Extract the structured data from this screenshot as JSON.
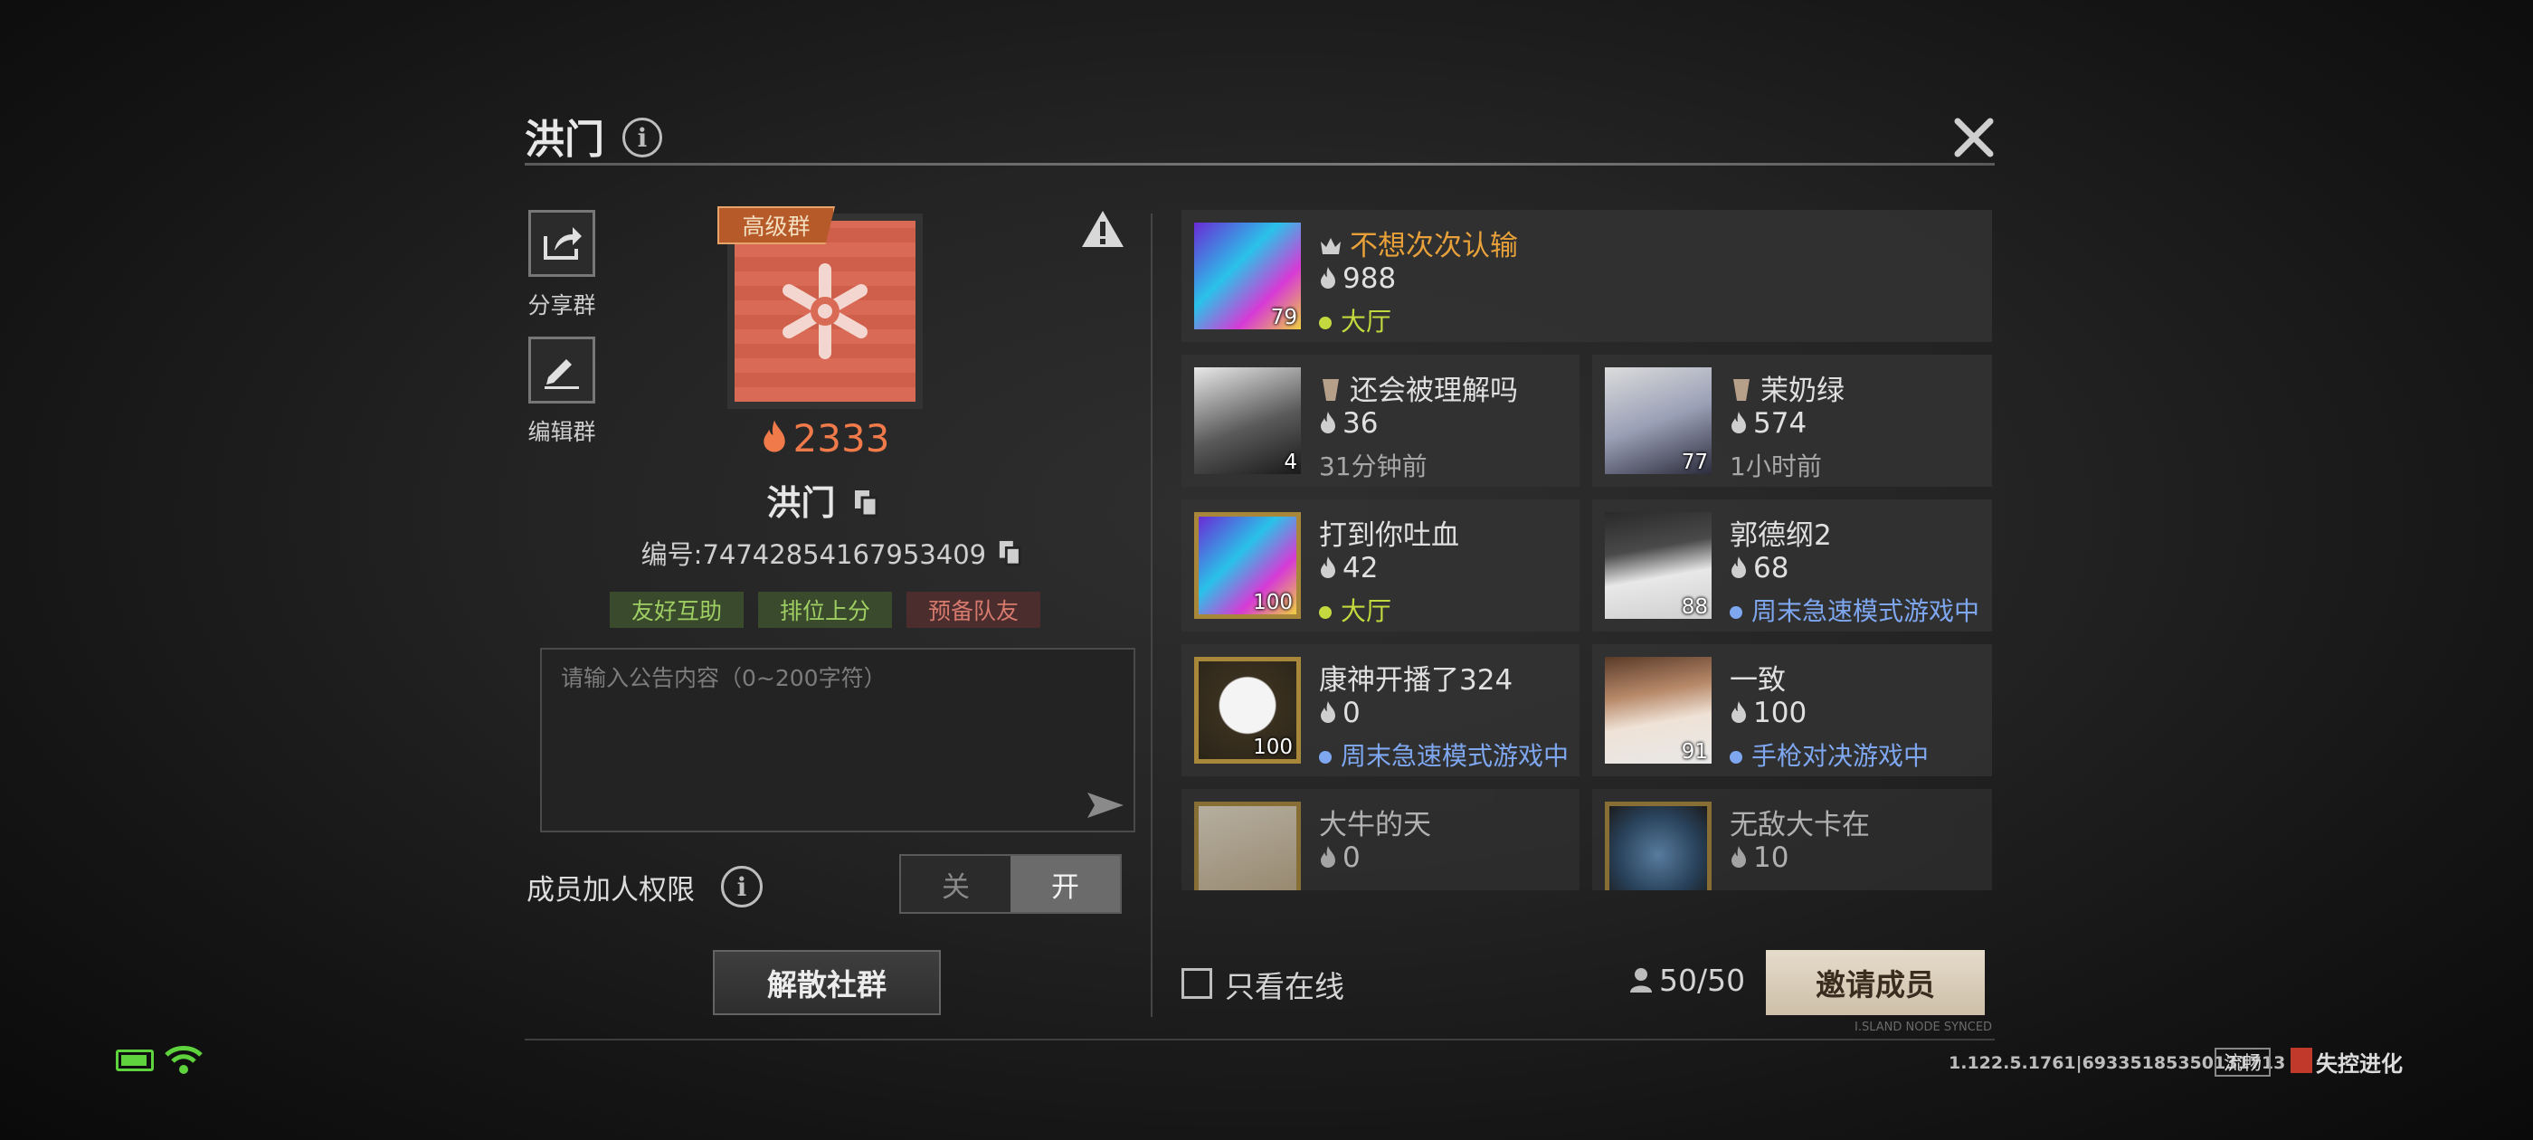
{
  "header": {
    "title": "洪门"
  },
  "side": {
    "share_label": "分享群",
    "edit_label": "编辑群"
  },
  "group": {
    "badge": "高级群",
    "score": "2333",
    "name": "洪门",
    "id_text": "编号:74742854167953409",
    "tags": [
      "友好互助",
      "排位上分",
      "预备队友"
    ]
  },
  "notice": {
    "placeholder": "请输入公告内容（0~200字符）"
  },
  "permission": {
    "label": "成员加人权限",
    "off": "关",
    "on": "开"
  },
  "actions": {
    "disband": "解散社群",
    "invite": "邀请成员"
  },
  "members": [
    {
      "name": "不想次次认输",
      "score": "988",
      "status": "大厅",
      "level": "79"
    },
    {
      "name": "还会被理解吗",
      "score": "36",
      "status": "31分钟前",
      "level": "4"
    },
    {
      "name": "茉奶绿",
      "score": "574",
      "status": "1小时前",
      "level": "77"
    },
    {
      "name": "打到你吐血",
      "score": "42",
      "status": "大厅",
      "level": "100"
    },
    {
      "name": "郭德纲2",
      "score": "68",
      "status": "周末急速模式游戏中",
      "level": "88"
    },
    {
      "name": "康神开播了324",
      "score": "0",
      "status": "周末急速模式游戏中",
      "level": "100"
    },
    {
      "name": "一致",
      "score": "100",
      "status": "手枪对决游戏中",
      "level": "91"
    },
    {
      "name": "大牛的天",
      "score": "0",
      "status": "",
      "level": ""
    },
    {
      "name": "无敌大卡在",
      "score": "10",
      "status": "",
      "level": ""
    }
  ],
  "footer": {
    "online_only": "只看在线",
    "member_count": "50/50",
    "net_label": "I.SLAND NODE SYNCED",
    "version": "1.122.5.1761|69335185350131713",
    "fluency": "流畅",
    "logo": "失控进化"
  },
  "colors": {
    "accent_orange": "#f07a4a",
    "status_green": "#c4d93e",
    "status_blue": "#7ea7f0",
    "owner_orange": "#e8a13a"
  }
}
